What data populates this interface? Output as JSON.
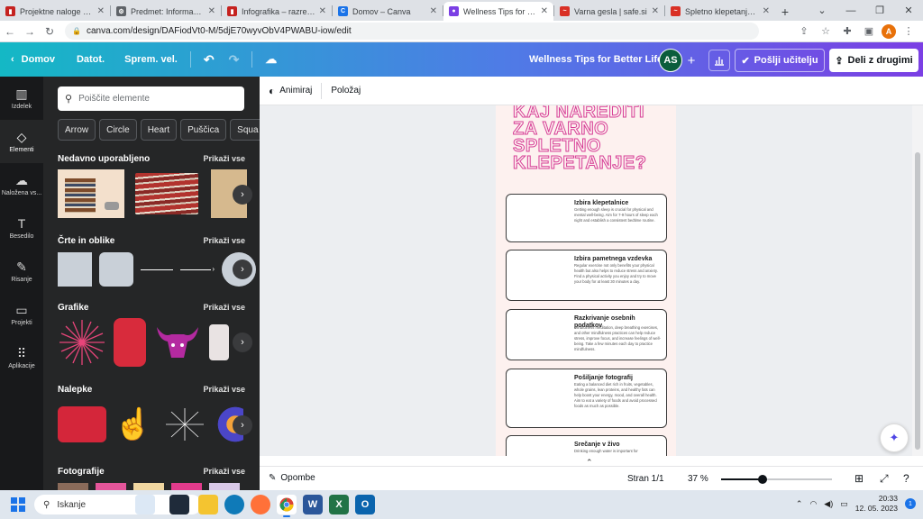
{
  "browser": {
    "tabs": [
      {
        "title": "Projektne naloge – ra",
        "fav_color": "#c5221f",
        "fav_glyph": "▮",
        "active": false
      },
      {
        "title": "Predmet: Informacijsk",
        "fav_color": "#5f6368",
        "fav_glyph": "⚙",
        "active": false
      },
      {
        "title": "Infografika – razrednik",
        "fav_color": "#c5221f",
        "fav_glyph": "▮",
        "active": false
      },
      {
        "title": "Domov – Canva",
        "fav_color": "#1a73e8",
        "fav_glyph": "C",
        "active": false
      },
      {
        "title": "Wellness Tips for Bette",
        "fav_color": "#7b3fe4",
        "fav_glyph": "●",
        "active": true
      },
      {
        "title": "Varna gesla | safe.si",
        "fav_color": "#d93025",
        "fav_glyph": "~",
        "active": false
      },
      {
        "title": "Spletno klepetanje | s",
        "fav_color": "#d93025",
        "fav_glyph": "~",
        "active": false
      }
    ],
    "url": "canva.com/design/DAFiodVt0-M/5djE70wyvObV4PWABU-iow/edit"
  },
  "header": {
    "home_label": "Domov",
    "file_label": "Datot.",
    "resize_label": "Sprem. vel.",
    "doc_title": "Wellness Tips for Better Life",
    "avatar_initials": "AS",
    "send_teacher_label": "Pošlji učitelju",
    "share_label": "Deli z drugimi"
  },
  "rail": [
    {
      "label": "Izdelek",
      "icon": "▥"
    },
    {
      "label": "Elementi",
      "icon": "◇"
    },
    {
      "label": "Naložena vs...",
      "icon": "☁"
    },
    {
      "label": "Besedilo",
      "icon": "T"
    },
    {
      "label": "Risanje",
      "icon": "✎"
    },
    {
      "label": "Projekti",
      "icon": "▭"
    },
    {
      "label": "Aplikacije",
      "icon": "⠿"
    }
  ],
  "panel": {
    "search_placeholder": "Poiščite elemente",
    "chips": [
      "Arrow",
      "Circle",
      "Heart",
      "Puščica",
      "Squa"
    ],
    "see_all": "Prikaži vse",
    "sections": {
      "recent": "Nedavno uporabljeno",
      "shapes": "Črte in oblike",
      "graphics": "Grafike",
      "stickers": "Nalepke",
      "photos": "Fotografije"
    }
  },
  "toolbar": {
    "animate_label": "Animiraj",
    "position_label": "Položaj"
  },
  "design": {
    "title": "KAJ NAREDITI ZA VARNO SPLETNO KLEPETANJE?",
    "cards": [
      {
        "title": "Izbira klepetalnice",
        "body": "Getting enough sleep is crucial for physical and mental well-being. Aim for 7-9 hours of sleep each night and establish a consistent bedtime routine."
      },
      {
        "title": "Izbira pametnega vzdevka",
        "body": "Regular exercise not only benefits your physical health but also helps to reduce stress and anxiety. Find a physical activity you enjoy and try to move your body for at least 30 minutes a day."
      },
      {
        "title": "Razkrivanje osebnih podatkov",
        "body": "Mindfulness meditation, deep breathing exercises, and other mindfulness practices can help reduce stress, improve focus, and increase feelings of well-being. Take a few minutes each day to practice mindfulness."
      },
      {
        "title": "Pošiljanje fotografij",
        "body": "Eating a balanced diet rich in fruits, vegetables, whole grains, lean proteins, and healthy fats can help boost your energy, mood, and overall health. Aim to eat a variety of foods and avoid processed foods as much as possible."
      },
      {
        "title": "Srečanje v živo",
        "body": "Drinking enough water is important for"
      }
    ]
  },
  "footer": {
    "notes_label": "Opombe",
    "page_label": "Stran 1/1",
    "zoom_label": "37 %",
    "zoom_fraction": 0.37
  },
  "taskbar": {
    "search_label": "Iskanje",
    "time": "20:33",
    "date": "12. 05. 2023"
  }
}
